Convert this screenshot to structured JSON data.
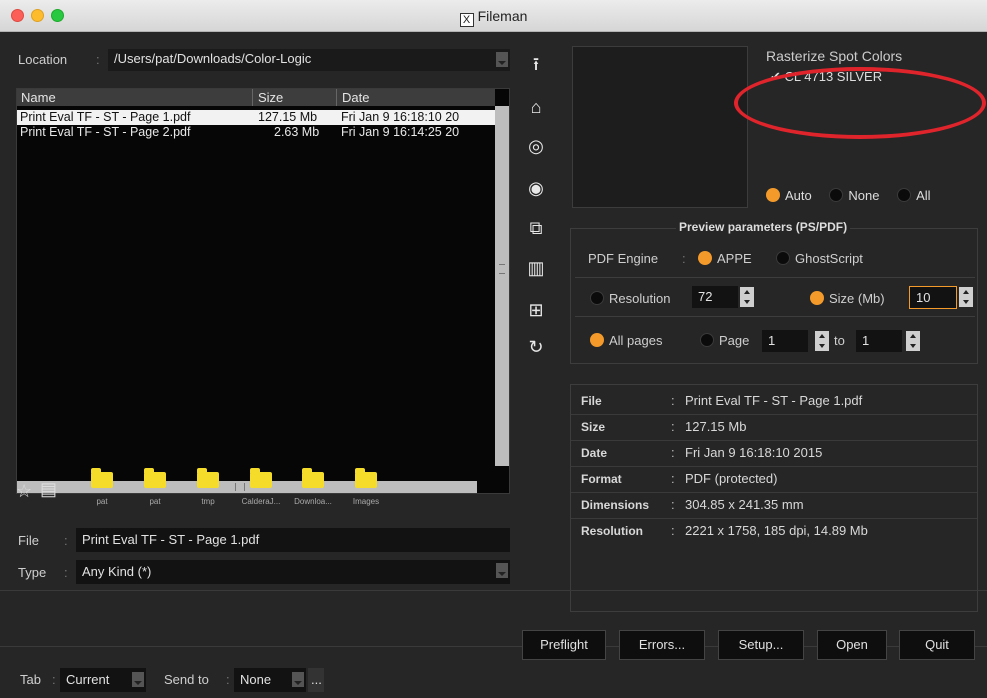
{
  "window": {
    "title": "Fileman"
  },
  "location": {
    "label": "Location",
    "path": "/Users/pat/Downloads/Color-Logic"
  },
  "filelist": {
    "columns": [
      "Name",
      "Size",
      "Date"
    ],
    "rows": [
      {
        "name": "Print Eval TF - ST - Page 1.pdf",
        "size": "127.15 Mb",
        "date": "Fri Jan  9 16:18:10 20"
      },
      {
        "name": "Print Eval TF - ST - Page 2.pdf",
        "size": "2.63 Mb",
        "date": "Fri Jan  9 16:14:25 20"
      }
    ]
  },
  "bookmarks": [
    "pat",
    "pat",
    "tmp",
    "CalderaJ...",
    "Downloa...",
    "Images"
  ],
  "file_field": {
    "label": "File",
    "value": "Print Eval TF - ST - Page 1.pdf"
  },
  "type_field": {
    "label": "Type",
    "value": "Any Kind (*)"
  },
  "spot": {
    "title": "Rasterize Spot Colors",
    "item": "CL 4713 SILVER",
    "checked": true
  },
  "preview_mode": {
    "options": [
      "Auto",
      "None",
      "All"
    ],
    "selected": "Auto"
  },
  "params": {
    "title": "Preview parameters (PS/PDF)",
    "engine_label": "PDF Engine",
    "engines": [
      "APPE",
      "GhostScript"
    ],
    "engine_selected": "APPE",
    "resolution_label": "Resolution",
    "resolution_value": "72",
    "size_label": "Size (Mb)",
    "size_value": "10",
    "all_pages_label": "All pages",
    "page_label": "Page",
    "page_from": "1",
    "to_label": "to",
    "page_to": "1"
  },
  "info": [
    {
      "key": "File",
      "value": "Print Eval TF - ST - Page 1.pdf"
    },
    {
      "key": "Size",
      "value": "127.15 Mb"
    },
    {
      "key": "Date",
      "value": "Fri Jan  9 16:18:10 2015"
    },
    {
      "key": "Format",
      "value": "PDF (protected)"
    },
    {
      "key": "Dimensions",
      "value": "304.85 x 241.35 mm"
    },
    {
      "key": "Resolution",
      "value": "2221 x 1758, 185 dpi, 14.89 Mb"
    }
  ],
  "footer": {
    "tab_label": "Tab",
    "tab_value": "Current",
    "sendto_label": "Send to",
    "sendto_value": "None",
    "more": "...",
    "buttons": [
      "Preflight",
      "Errors...",
      "Setup...",
      "Open",
      "Quit"
    ]
  },
  "colors": {
    "accent": "#f39a2a",
    "highlight": "#e0242c",
    "background": "#262626"
  }
}
